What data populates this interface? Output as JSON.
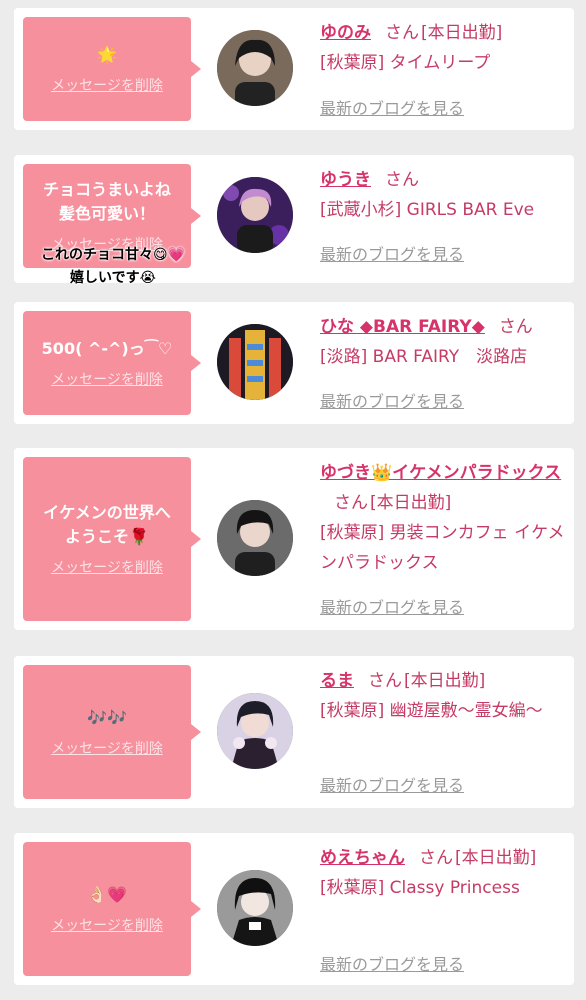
{
  "overlay_caption": "これのチョコ甘々😋💗\n嬉しいです😭",
  "delete_label": "メッセージを削除",
  "blog_label": "最新のブログを見る",
  "san_label": "さん",
  "cards": [
    {
      "message": "🌟",
      "name": "ゆのみ",
      "status": "[本日出勤]",
      "shop": "[秋葉原] タイムリープ"
    },
    {
      "message": "チョコうまいよね\n髪色可愛い！",
      "name": "ゆうき",
      "status": "",
      "shop": "[武蔵小杉] GIRLS BAR Eve"
    },
    {
      "message": "500( ^-^)っ⁀♡",
      "name": "ひな ◆BAR FAIRY◆",
      "status": "",
      "shop": "[淡路] BAR FAIRY　淡路店"
    },
    {
      "message": "イケメンの世界へ\nようこそ🌹",
      "name": "ゆづき👑イケメンパラドックス",
      "status": "[本日出勤]",
      "shop": "[秋葉原] 男装コンカフェ イケメンパラドックス"
    },
    {
      "message": "🎶🎶",
      "name": "るま",
      "status": "[本日出勤]",
      "shop": "[秋葉原] 幽遊屋敷〜霊女編〜"
    },
    {
      "message": "👌🏻💗",
      "name": "めえちゃん",
      "status": "[本日出勤]",
      "shop": "[秋葉原] Classy Princess"
    }
  ],
  "colors": {
    "background": "#ececec",
    "bubble": "#f7909d",
    "name": "#d7336b",
    "text_pink": "#c63b66",
    "link_gray": "#9a9a9a"
  }
}
